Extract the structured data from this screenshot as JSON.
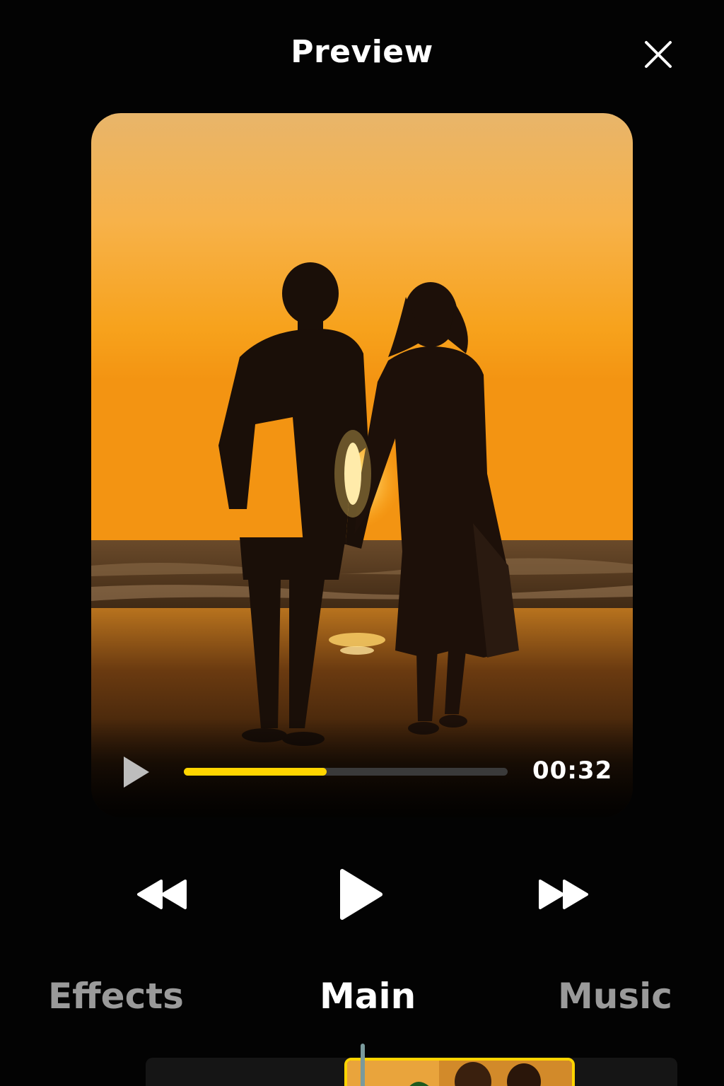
{
  "header": {
    "title": "Preview",
    "close_icon": "close-icon"
  },
  "preview": {
    "media_description": "sunset-beach-video",
    "player": {
      "play_icon": "play-icon",
      "progress": 0.44,
      "time": "00:32"
    }
  },
  "controls": {
    "rewind_icon": "rewind-icon",
    "play_icon": "play-icon",
    "forward_icon": "fast-forward-icon"
  },
  "tabs": [
    {
      "label": "Effects",
      "active": false
    },
    {
      "label": "Main",
      "active": true
    },
    {
      "label": "Music",
      "active": false
    }
  ],
  "timeline": {
    "accent_color": "#ffd500"
  },
  "colors": {
    "accent": "#ffd500",
    "background": "#030303",
    "inactive_tab": "#9a9a9a"
  }
}
